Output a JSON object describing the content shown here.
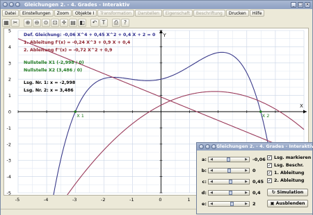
{
  "window": {
    "title": "Gleichungen 2. - 4. Grades - Interaktiv"
  },
  "menu": [
    {
      "label": "Datei",
      "disabled": false
    },
    {
      "label": "Einstellungen",
      "disabled": false
    },
    {
      "label": "Zoom",
      "disabled": false
    },
    {
      "label": "Objekte I",
      "disabled": false
    },
    {
      "label": "Transformation",
      "disabled": true
    },
    {
      "label": "Darstellen",
      "disabled": true
    },
    {
      "label": "Eigenschaft",
      "disabled": true
    },
    {
      "label": "Beschriftung",
      "disabled": true
    },
    {
      "label": "Drucken",
      "disabled": false
    },
    {
      "label": "Hilfe",
      "disabled": false
    }
  ],
  "toolbar": {
    "icons": [
      "calculator-icon",
      "cut-icon",
      "zoom-in-icon",
      "zoom-out-icon",
      "zoom-fit-icon",
      "zoom-box-icon",
      "crosshair-icon",
      "grid-icon",
      "color-icon",
      "undo-icon",
      "text-icon",
      "print-icon",
      "help-icon"
    ]
  },
  "info": {
    "line1": "Def. Gleichung: -0,06 X^4 + 0,45 X^2 + 0,4 X + 2 = 0",
    "line2": "1. Ableitung f'(x) = -0,24 X^3 + 0,9 X + 0,4",
    "line3": "2. Ableitung f''(x) = -0,72 X^2 + 0,9",
    "line4": "Nullstelle X1 (-2,998 / 0)",
    "line5": "Nullstelle X2 (3,486 / 0)",
    "line6": "Lsg. Nr. 1: x = -2,998",
    "line7": "Lsg. Nr. 2: x = 3,486",
    "colors": {
      "def": "#2b2b8c",
      "first": "#8c1f2b",
      "second": "#8c1f2b",
      "roots": "#1f7a1f",
      "solutions": "#000000"
    }
  },
  "axes": {
    "x_letter": "X",
    "y_letter": "Y",
    "x_ticks": [
      "-5",
      "-4",
      "-3",
      "-2",
      "-1",
      "0",
      "1",
      "2",
      "3",
      "4",
      "5"
    ],
    "y_ticks": [
      "5",
      "4",
      "3",
      "2",
      "1",
      "0",
      "-1",
      "-2",
      "-3",
      "-4",
      "-5"
    ],
    "marker_x1": "X 1",
    "marker_x2": "X 2"
  },
  "chart_data": {
    "type": "line",
    "xlim": [
      -5,
      5
    ],
    "ylim": [
      -5,
      5
    ],
    "grid": true,
    "series": [
      {
        "color": "#3a3a8a",
        "coef": [
          -0.06,
          0,
          0.45,
          0.4,
          2
        ]
      },
      {
        "color": "#9a3a5a",
        "coef": [
          -0.24,
          0.9,
          0.4
        ]
      },
      {
        "color": "#9a3a5a",
        "coef": [
          -0.72,
          0.9
        ]
      }
    ],
    "roots": [
      -2.998,
      3.486
    ]
  },
  "dialog": {
    "title": "Gleichungen 2. - 4. Grades - Interaktiv",
    "sliders": [
      {
        "label": "a:",
        "value": "-0,06",
        "pos": 0.47
      },
      {
        "label": "b:",
        "value": "0",
        "pos": 0.5
      },
      {
        "label": "c:",
        "value": "0,45",
        "pos": 0.55
      },
      {
        "label": "d:",
        "value": "0,4",
        "pos": 0.54
      },
      {
        "label": "e:",
        "value": "2",
        "pos": 0.6
      }
    ],
    "checks": [
      {
        "label": "Lsg. markieren",
        "checked": true
      },
      {
        "label": "Lsg. Beschr.",
        "checked": true
      },
      {
        "label": "1. Ableitung",
        "checked": true
      },
      {
        "label": "2. Ableitung",
        "checked": true
      }
    ],
    "sim_button": "Simulation",
    "hide_button": "Ausblenden"
  }
}
